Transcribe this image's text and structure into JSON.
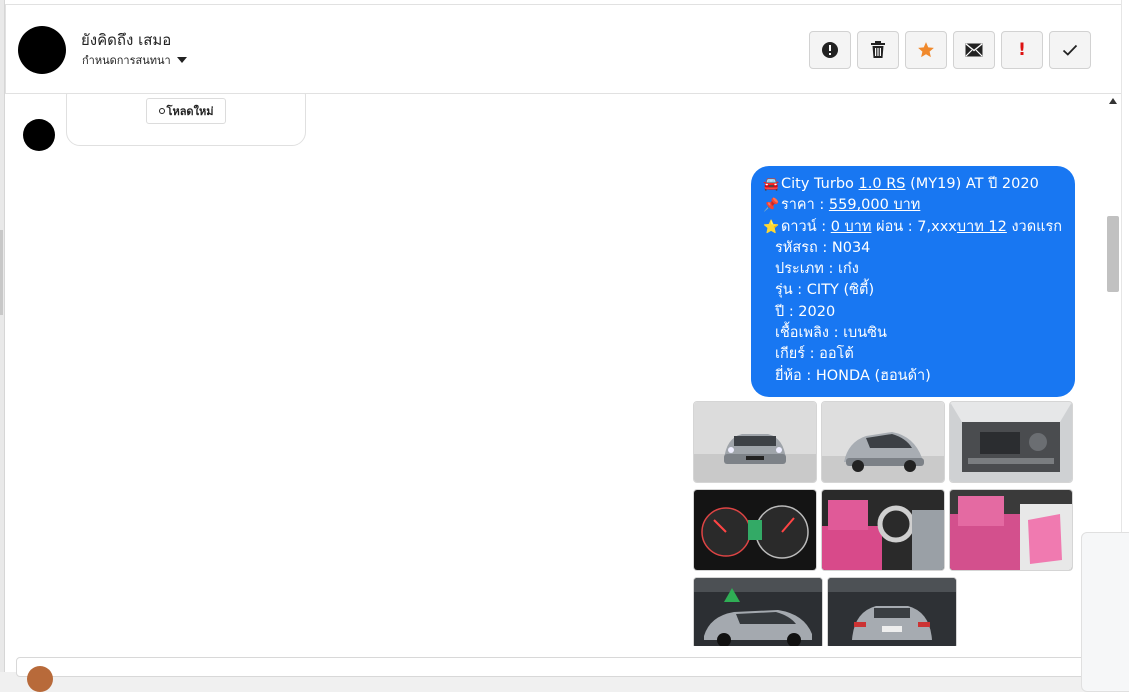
{
  "header": {
    "contact_name": "ยังคิดถึง เสมอ",
    "label_select": "กำหนดการสนทนา",
    "actions": [
      {
        "name": "report-button",
        "icon": "exclamation-circle-icon"
      },
      {
        "name": "delete-button",
        "icon": "trash-icon"
      },
      {
        "name": "star-button",
        "icon": "star-icon"
      },
      {
        "name": "mark-unread-button",
        "icon": "envelope-icon"
      },
      {
        "name": "important-button",
        "icon": "exclamation-icon"
      },
      {
        "name": "done-button",
        "icon": "check-icon"
      }
    ]
  },
  "incoming": {
    "reload_label": "โหลดใหม่"
  },
  "outgoing": {
    "line1_prefix": "City Turbo ",
    "line1_link": "1.0 RS",
    "line1_suffix": " (MY19) AT ปี 2020",
    "line2_prefix": "ราคา : ",
    "line2_link": "559,000 บาท",
    "line3_prefix": "ดาวน์ : ",
    "line3_link1": "0 บาท",
    "line3_mid": " ผ่อน : 7,xxx",
    "line3_link2": "บาท 12",
    "line3_suffix": " งวดแรก",
    "code": "รหัสรถ : N034",
    "type": "ประเภท : เก๋ง",
    "model": "รุ่น : CITY (ซิตี้)",
    "year": "ปี : 2020",
    "fuel": "เชื้อเพลิง : เบนซิน",
    "gear": "เกียร์ : ออโต้",
    "brand": "ยี่ห้อ : HONDA (ฮอนด้า)"
  },
  "colors": {
    "bubble": "#1877f2",
    "star": "#f0892c",
    "important": "#dd1111"
  },
  "photos": [
    {
      "name": "car-front-photo"
    },
    {
      "name": "car-front-angle-photo"
    },
    {
      "name": "engine-bay-photo"
    },
    {
      "name": "dashboard-gauges-photo"
    },
    {
      "name": "interior-driver-photo"
    },
    {
      "name": "interior-seats-photo"
    },
    {
      "name": "car-rear-angle-photo"
    },
    {
      "name": "car-rear-photo"
    }
  ]
}
